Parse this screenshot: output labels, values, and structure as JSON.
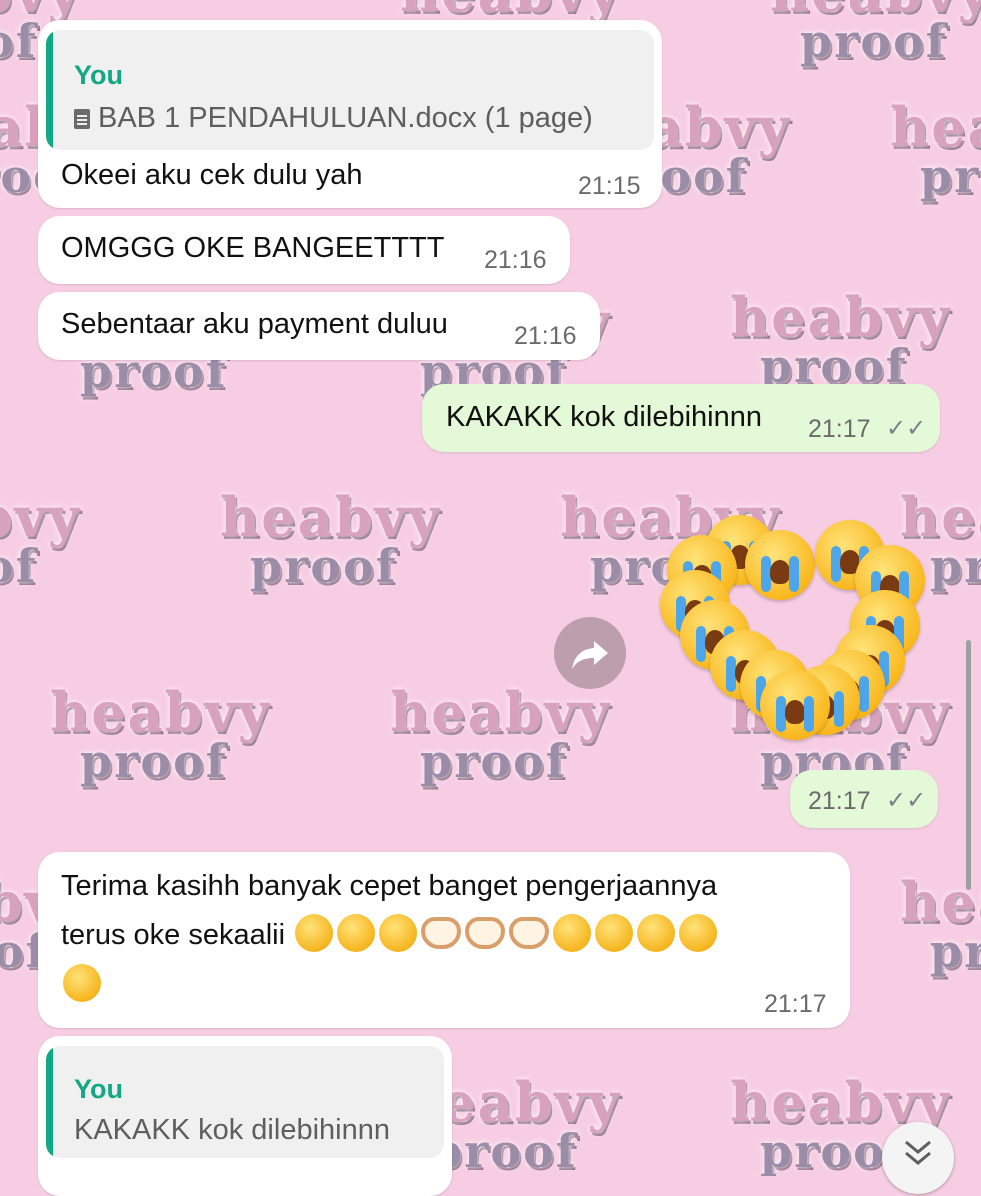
{
  "wallpaper": {
    "word1": "heabvy",
    "word2": "proof"
  },
  "messages": [
    {
      "quote": {
        "author": "You",
        "text": "BAB 1 PENDAHULUAN.docx (1 page)",
        "icon": "document-icon"
      },
      "text": "Okeei aku cek dulu yah",
      "time": "21:15"
    },
    {
      "text": "OMGGG OKE BANGEETTTT",
      "time": "21:16"
    },
    {
      "text": "Sebentaar aku payment duluu",
      "time": "21:16"
    },
    {
      "text": "KAKAKK kok dilebihinnn",
      "time": "21:17",
      "ticks": "✓✓"
    },
    {
      "sticker": "crying-faces-heart-sticker",
      "time": "21:17",
      "ticks": "✓✓"
    },
    {
      "line1": "Terima kasihh banyak cepet banget pengerjaannya",
      "line2": "terus oke sekaalii",
      "time": "21:17"
    },
    {
      "quote": {
        "author": "You",
        "text": "KAKAKK kok dilebihinnn"
      }
    }
  ],
  "icons": {
    "forward": "forward-icon",
    "scroll_down": "chevron-double-down-icon"
  },
  "colors": {
    "wallpaper": "#f7cde3",
    "incoming": "#ffffff",
    "outgoing": "#e3f9d7",
    "accent": "#12a883"
  }
}
